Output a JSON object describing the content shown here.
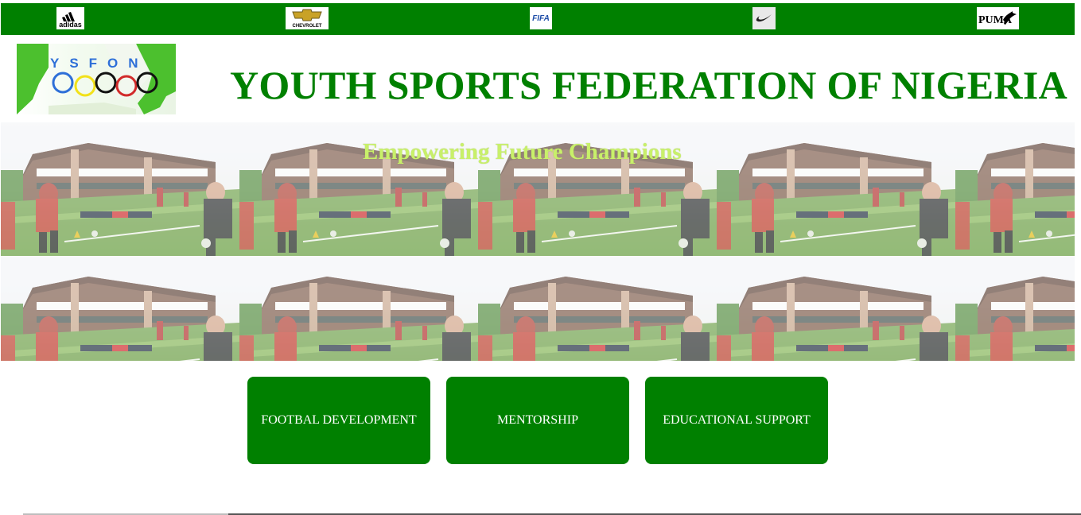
{
  "sponsors": [
    {
      "name": "adidas",
      "label": "adidas",
      "icon": "adidas-logo-icon"
    },
    {
      "name": "chevrolet",
      "label": "CHEVROLET",
      "icon": "chevrolet-logo-icon"
    },
    {
      "name": "fifa",
      "label": "FIFA",
      "icon": "fifa-logo-icon"
    },
    {
      "name": "nike",
      "label": "",
      "icon": "nike-logo-icon"
    },
    {
      "name": "puma",
      "label": "PUMA",
      "icon": "puma-logo-icon"
    }
  ],
  "header": {
    "logo_text": "YSFON",
    "title": "YOUTH SPORTS FEDERATION OF NIGERIA"
  },
  "hero": {
    "tagline": "Empowering Future Champions",
    "image": "training-ground-photo"
  },
  "services": [
    {
      "label": "FOOTBAL DEVELOPMENT"
    },
    {
      "label": "MENTORSHIP"
    },
    {
      "label": "EDUCATIONAL SUPPORT"
    }
  ],
  "colors": {
    "brand_green": "#008000",
    "tagline": "#c8f06a",
    "button_text": "#ffffff"
  }
}
